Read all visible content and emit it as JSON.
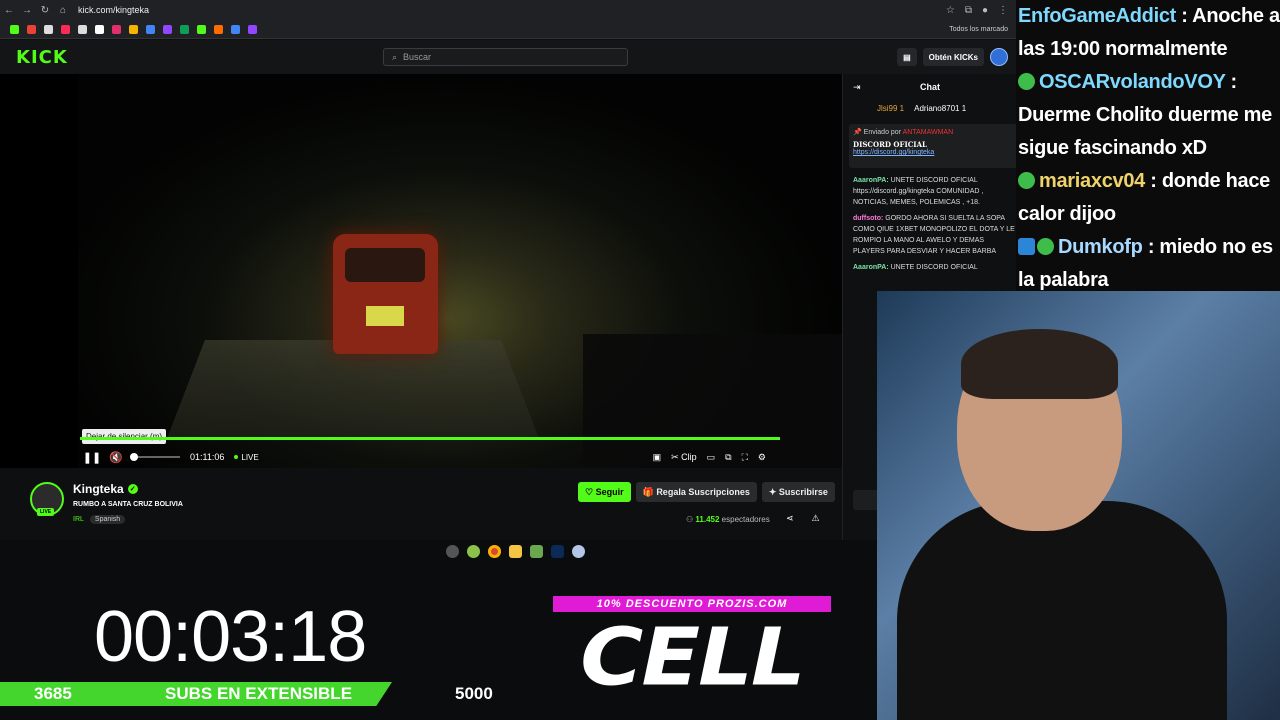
{
  "browser": {
    "url": "kick.com/kingteka",
    "bookmarks_all": "Todos los marcado"
  },
  "kick": {
    "logo": "KICK",
    "search_placeholder": "Buscar",
    "get_kicks": "Obtén KICKs"
  },
  "player": {
    "tooltip": "Dejar de silenciar (m)",
    "time": "01:11:06",
    "live": "LIVE",
    "clip": "Clip",
    "progress_fraction": 1.0
  },
  "channel": {
    "name": "Kingteka",
    "live_tag": "LIVE",
    "title": "RUMBO A SANTA CRUZ BOLIVIA",
    "category": "IRL",
    "language": "Spanish",
    "follow": "Seguir",
    "gift": "Regala Suscripciones",
    "subscribe": "Suscribirse",
    "viewers_count": "11.452",
    "viewers_label": "espectadores"
  },
  "chat": {
    "title": "Chat",
    "gifters": [
      "Jlsi99 1",
      "Adriano8701 1"
    ],
    "pinned_by_label": "Enviado por",
    "pinned_by_user": "ANTAMAWMAN",
    "pinned_title": "DISCORD OFICIAL",
    "pinned_link": "https://discord.gg/kingteka",
    "messages": [
      {
        "user": "AaaronPA:",
        "text": " UNETE DISCORD OFICIAL https://discord.gg/kingteka COMUNIDAD , NOTICIAS, MEMES, POLEMICAS , +18."
      },
      {
        "user": "duffsoto:",
        "text": " GORDO AHORA SI SUELTA LA SOPA COMO QIUE 1XBET MONOPOLIZO EL DOTA Y LE ROMPIO LA MANO AL AWELO Y DEMAS PLAYERS PARA DESVIAR Y HACER BARBA"
      },
      {
        "user": "AaaronPA:",
        "text": " UNETE DISCORD OFICIAL"
      }
    ]
  },
  "overlay": {
    "timer": "00:03:18",
    "sub_current": "3685",
    "sub_label": "SUBS EN EXTENSIBLE",
    "sub_goal": "5000",
    "promo": "10% DESCUENTO PROZIS.COM",
    "brand": "CELL"
  },
  "stream_chat": [
    {
      "user": "EnfoGameAddict",
      "text": " : Anoche a las 19:00 normalmente"
    },
    {
      "user": "OSCARvolandoVOY",
      "text": " : Duerme Cholito duerme me sigue fascinando xD"
    },
    {
      "user": "mariaxcv04",
      "text": " : donde hace calor dijoo"
    },
    {
      "user": "Dumkofp",
      "text": " : miedo no es la palabra"
    }
  ],
  "colors": {
    "kick_green": "#53fc18",
    "promo_magenta": "#e01bd6",
    "sub_bar": "#44d62c"
  }
}
